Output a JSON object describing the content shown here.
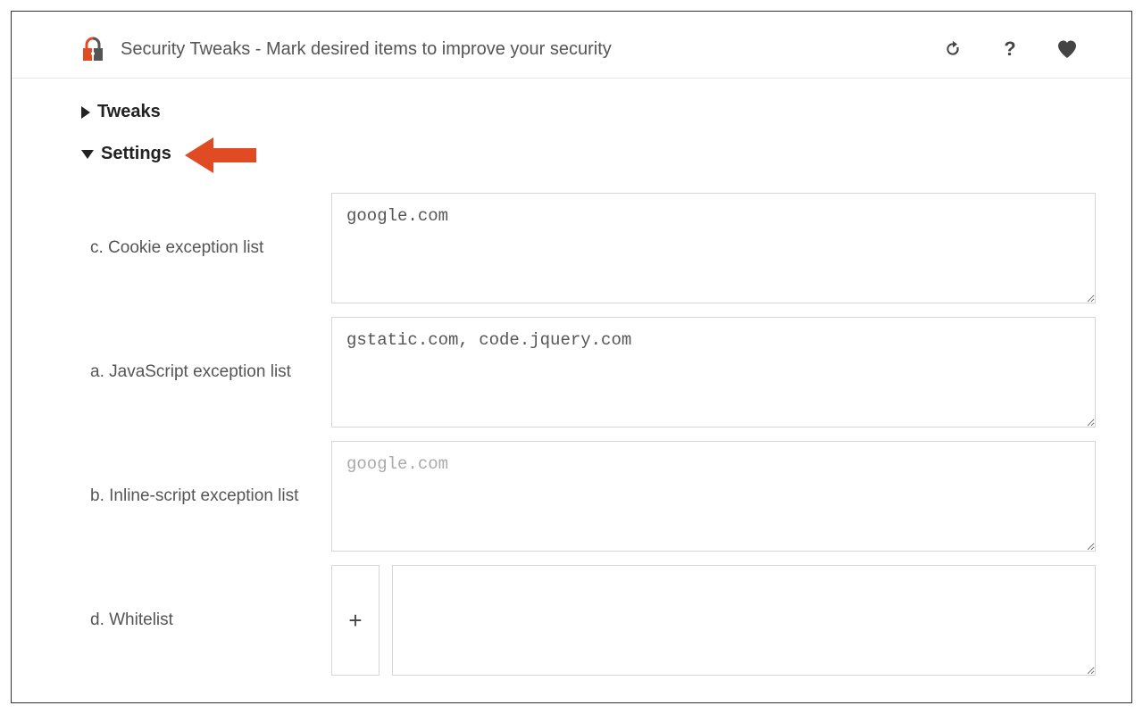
{
  "header": {
    "title": "Security Tweaks - Mark desired items to improve your security",
    "icons": {
      "refresh": "refresh-icon",
      "help": "?",
      "favorite": "heart-icon",
      "lock": "lock-icon"
    }
  },
  "sections": {
    "tweaks": {
      "label": "Tweaks",
      "expanded": false
    },
    "settings": {
      "label": "Settings",
      "expanded": true
    }
  },
  "fields": {
    "cookie_exception": {
      "label": "c. Cookie exception list",
      "value": "google.com",
      "placeholder": ""
    },
    "javascript_exception": {
      "label": "a. JavaScript exception list",
      "value": "gstatic.com, code.jquery.com",
      "placeholder": ""
    },
    "inline_script_exception": {
      "label": "b. Inline-script exception list",
      "value": "",
      "placeholder": "google.com"
    },
    "whitelist": {
      "label": "d. Whitelist",
      "value": "",
      "placeholder": "",
      "add_label": "+"
    }
  },
  "callout": {
    "target": "settings",
    "color": "#e14b24"
  }
}
